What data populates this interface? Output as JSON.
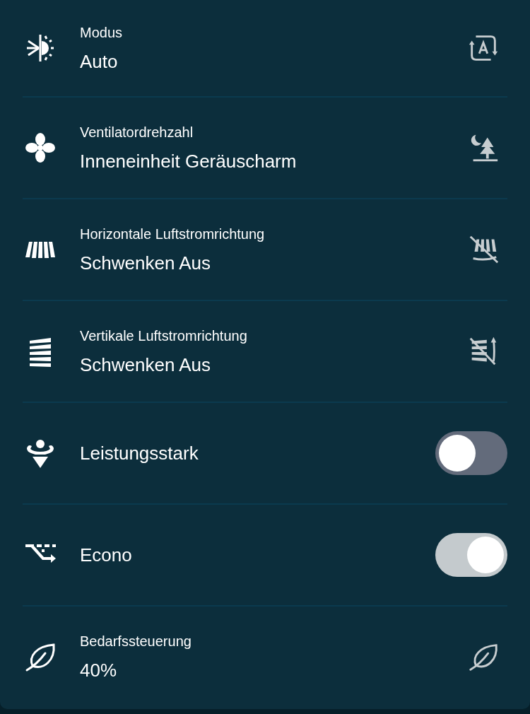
{
  "settings": [
    {
      "kind": "setting",
      "label": "Modus",
      "value": "Auto"
    },
    {
      "kind": "setting",
      "label": "Ventilatordrehzahl",
      "value": "Inneneinheit Geräuscharm"
    },
    {
      "kind": "setting",
      "label": "Horizontale Luftstromrichtung",
      "value": "Schwenken Aus"
    },
    {
      "kind": "setting",
      "label": "Vertikale Luftstromrichtung",
      "value": "Schwenken Aus"
    },
    {
      "kind": "toggle",
      "label": "Leistungsstark",
      "on": false
    },
    {
      "kind": "toggle",
      "label": "Econo",
      "on": true
    },
    {
      "kind": "setting",
      "label": "Bedarfssteuerung",
      "value": "40%"
    }
  ]
}
